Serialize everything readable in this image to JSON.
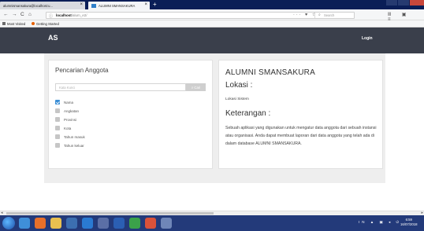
{
  "browser": {
    "tabs": [
      {
        "title": "alumnismansakura@localhost:u...",
        "close": "×"
      },
      {
        "title": "ALUMNI SMANSAKURA",
        "close": "×"
      }
    ],
    "new_tab": "+",
    "nav": {
      "back": "←",
      "forward": "→",
      "reload": "C",
      "home": "⌂"
    },
    "url": {
      "host": "localhost",
      "path": "/alum_e2/"
    },
    "url_actions": "··· ♥ ☆",
    "search_placeholder": "Search",
    "toolbar_icons": "Ⅲ ▣ ≡",
    "bookmarks": [
      {
        "label": "Most Visited",
        "color": "#6b6b6b"
      },
      {
        "label": "Getting Started",
        "color": "#e66000"
      }
    ]
  },
  "site": {
    "brand": "AS",
    "login": "Login"
  },
  "search_panel": {
    "title": "Pencarian Anggota",
    "input_placeholder": "Kata Kunci",
    "button_label": "Cari",
    "options": [
      {
        "label": "Nama",
        "checked": true
      },
      {
        "label": "Angkatan",
        "checked": false
      },
      {
        "label": "Provinsi",
        "checked": false
      },
      {
        "label": "Kota",
        "checked": false
      },
      {
        "label": "Tahun masuk",
        "checked": false
      },
      {
        "label": "Tahun keluar",
        "checked": false
      }
    ]
  },
  "info_panel": {
    "title": "ALUMNI SMANSAKURA",
    "location_heading": "Lokasi :",
    "location_value": "Lokasi Sistem",
    "description_heading": "Keterangan :",
    "description": "Sebuah aplikasi yang digunakan untuk mengatur data anggota dari sebuah instansi atau organisasi. Anda dapat membuat laporan dari data anggota yang telah ada di dalam database ALUMNI SMANSAKURA."
  },
  "taskbar": {
    "tray": "IN ▲ ▣ ◂ ⏻",
    "time": "6:59",
    "date": "16/07/2018"
  },
  "colors": {
    "header": "#3a3f4b",
    "accent": "#3b8fd6",
    "taskbar": "#233a7a"
  }
}
